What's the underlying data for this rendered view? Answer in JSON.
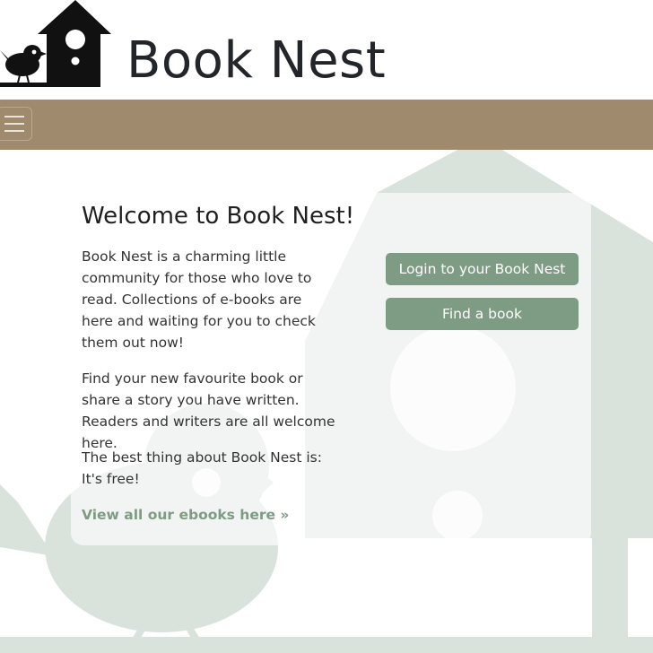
{
  "header": {
    "brand": "Book Nest"
  },
  "navbar": {
    "toggler": "menu-icon"
  },
  "main": {
    "title": "Welcome to Book Nest!",
    "paragraphs": [
      "Book Nest is a charming little community for those who love to read. Collections of e-books are here and waiting for you to check them out now!",
      "Find your new favourite book or share a story you have written. Readers and writers are all welcome here.",
      "The best thing about Book Nest is: It's free!"
    ],
    "link": "View all our ebooks here »",
    "buttons": {
      "login": "Login to your Book Nest",
      "find": "Find a book"
    }
  },
  "colors": {
    "navbar": "#a08a6d",
    "accent": "#7d9c83",
    "watermark": "#d9e3dc"
  }
}
